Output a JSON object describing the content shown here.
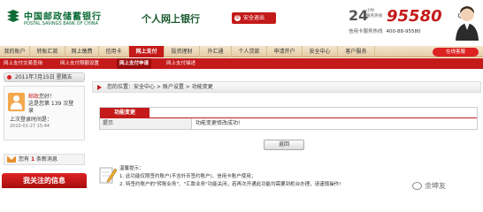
{
  "header": {
    "bank_name_cn": "中国邮政储蓄银行",
    "bank_name_en": "POSTAL SAVINGS BANK OF CHINA",
    "site_title": "个人网上银行",
    "logout_label": "安全退出",
    "hotline_24": "24",
    "hotline_unit": "小时",
    "hotline_sub": "服务热线",
    "hotline_number": "95580",
    "credit_card_hotline_label": "信用卡服务热线",
    "credit_card_hotline": "400-88-95580"
  },
  "nav": {
    "items": [
      "我的账户",
      "转账汇款",
      "网上缴费",
      "信用卡",
      "网上支付",
      "投资理财",
      "外汇通",
      "个人贷款",
      "申请开户",
      "安全中心",
      "客户服务"
    ],
    "active_index": 4,
    "online_label": "在线客服"
  },
  "subnav": {
    "items": [
      "网上支付交易查询",
      "网上支付限额设置",
      "网上支付申请",
      "网上支付描述"
    ],
    "active_index": 2
  },
  "sidebar": {
    "date": "2011年7月15日 星期五",
    "greeting_name": "邮政",
    "greeting_suffix": "您好！",
    "visit_count_line": "这是您第 139 次登",
    "visit_count_tail": "录",
    "last_login_label": "上次登录时间是：",
    "last_login_time": "2010-01-27 15:44",
    "message_prefix": "您有",
    "message_count": "1",
    "message_suffix": "条新消息",
    "focus_label": "我关注的信息"
  },
  "breadcrumb": {
    "prefix": "您的位置：",
    "path": "安全中心 > 账户设置 > 功能变更"
  },
  "result": {
    "title": "功能变更",
    "label": "提示",
    "message": "功能变更修改成功!"
  },
  "back_label": "返回",
  "tips": {
    "title": "温馨提示：",
    "line1": "1. 此功能仅限签约账户(不含外币签约账户)、信用卡账户使用；",
    "line2": "2. 特签约账户的\"转账业务\"、\"汇款业务\"功能关闭，若再次开通此功能均需要到柜台办理，请谨慎操作!"
  },
  "watermark": "余坤友",
  "colors": {
    "brand_green": "#0a6b35",
    "brand_red": "#c41a1a"
  }
}
